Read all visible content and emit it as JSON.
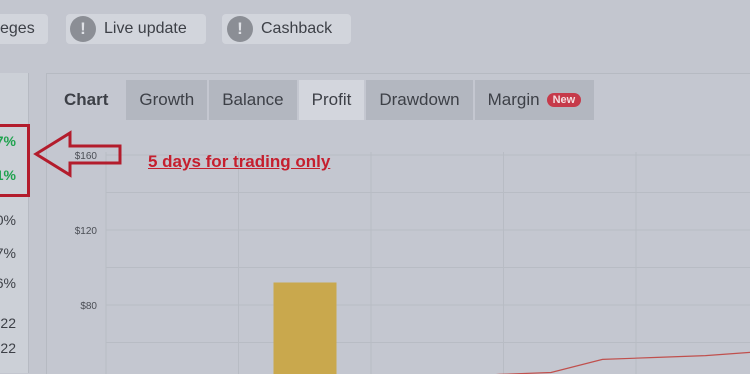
{
  "toolbar": {
    "items": [
      {
        "label": "eges",
        "icon": "exclamation-icon"
      },
      {
        "label": "Live update",
        "icon": "exclamation-icon"
      },
      {
        "label": "Cashback",
        "icon": "exclamation-icon"
      }
    ]
  },
  "stats": [
    "7%",
    "1%",
    "0%",
    "7%",
    "6%",
    "22",
    "22"
  ],
  "tabs": {
    "title": "Chart",
    "items": [
      "Growth",
      "Balance",
      "Profit",
      "Drawdown",
      "Margin"
    ],
    "active": "Profit",
    "new_badge": "New"
  },
  "annotation": "5 days for trading only",
  "colors": {
    "highlight": "#b31c2c",
    "bar": "#c9a84d",
    "line": "#c0504d",
    "positive": "#1fa24e"
  },
  "chart_data": {
    "type": "bar",
    "yticks": [
      "$160",
      "$120",
      "$80"
    ],
    "ylim": [
      40,
      160
    ],
    "bars": [
      {
        "index": 1,
        "value": 92
      }
    ],
    "line": {
      "values": [
        40,
        40.5,
        41.5,
        43,
        44,
        51,
        52,
        53,
        55
      ]
    },
    "grid": true
  }
}
